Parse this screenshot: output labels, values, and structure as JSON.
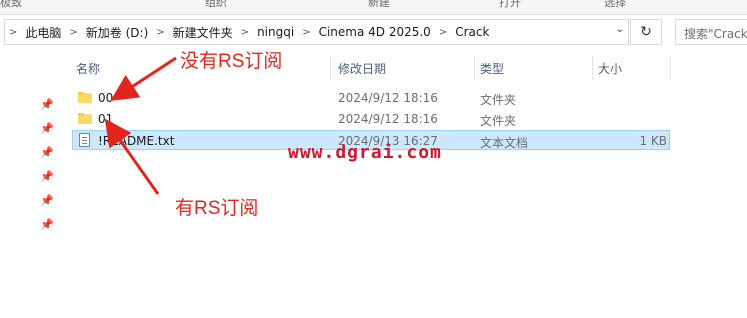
{
  "ribbon": {
    "items": [
      "极致",
      "组织",
      "新建",
      "打开",
      "选择"
    ]
  },
  "address": {
    "crumbs": [
      "此电脑",
      "新加卷 (D:)",
      "新建文件夹",
      "ningqi",
      "Cinema 4D 2025.0",
      "Crack"
    ],
    "separator": ">",
    "dropdown_icon": "chevron-down-icon",
    "refresh_icon": "refresh-icon"
  },
  "search": {
    "placeholder": "搜索\"Crack\""
  },
  "columns": {
    "name": "名称",
    "date": "修改日期",
    "type": "类型",
    "size": "大小"
  },
  "files": [
    {
      "name": "00",
      "date": "2024/9/12 18:16",
      "type": "文件夹",
      "size": "",
      "icon": "folder-icon"
    },
    {
      "name": "01",
      "date": "2024/9/12 18:16",
      "type": "文件夹",
      "size": "",
      "icon": "folder-icon"
    },
    {
      "name": "!README.txt",
      "date": "2024/9/13 16:27",
      "type": "文本文档",
      "size": "1 KB",
      "icon": "text-file-icon"
    }
  ],
  "quick_access_pins": 6,
  "annotations": {
    "no_rs": "没有RS订阅",
    "has_rs": "有RS订阅",
    "watermark": "www.dgrai.com"
  },
  "colors": {
    "selection_bg": "#cce8ff",
    "selection_border": "#99d1ff",
    "folder": "#f6c94a",
    "annotation": "#e2261c",
    "watermark": "#d0162a"
  }
}
